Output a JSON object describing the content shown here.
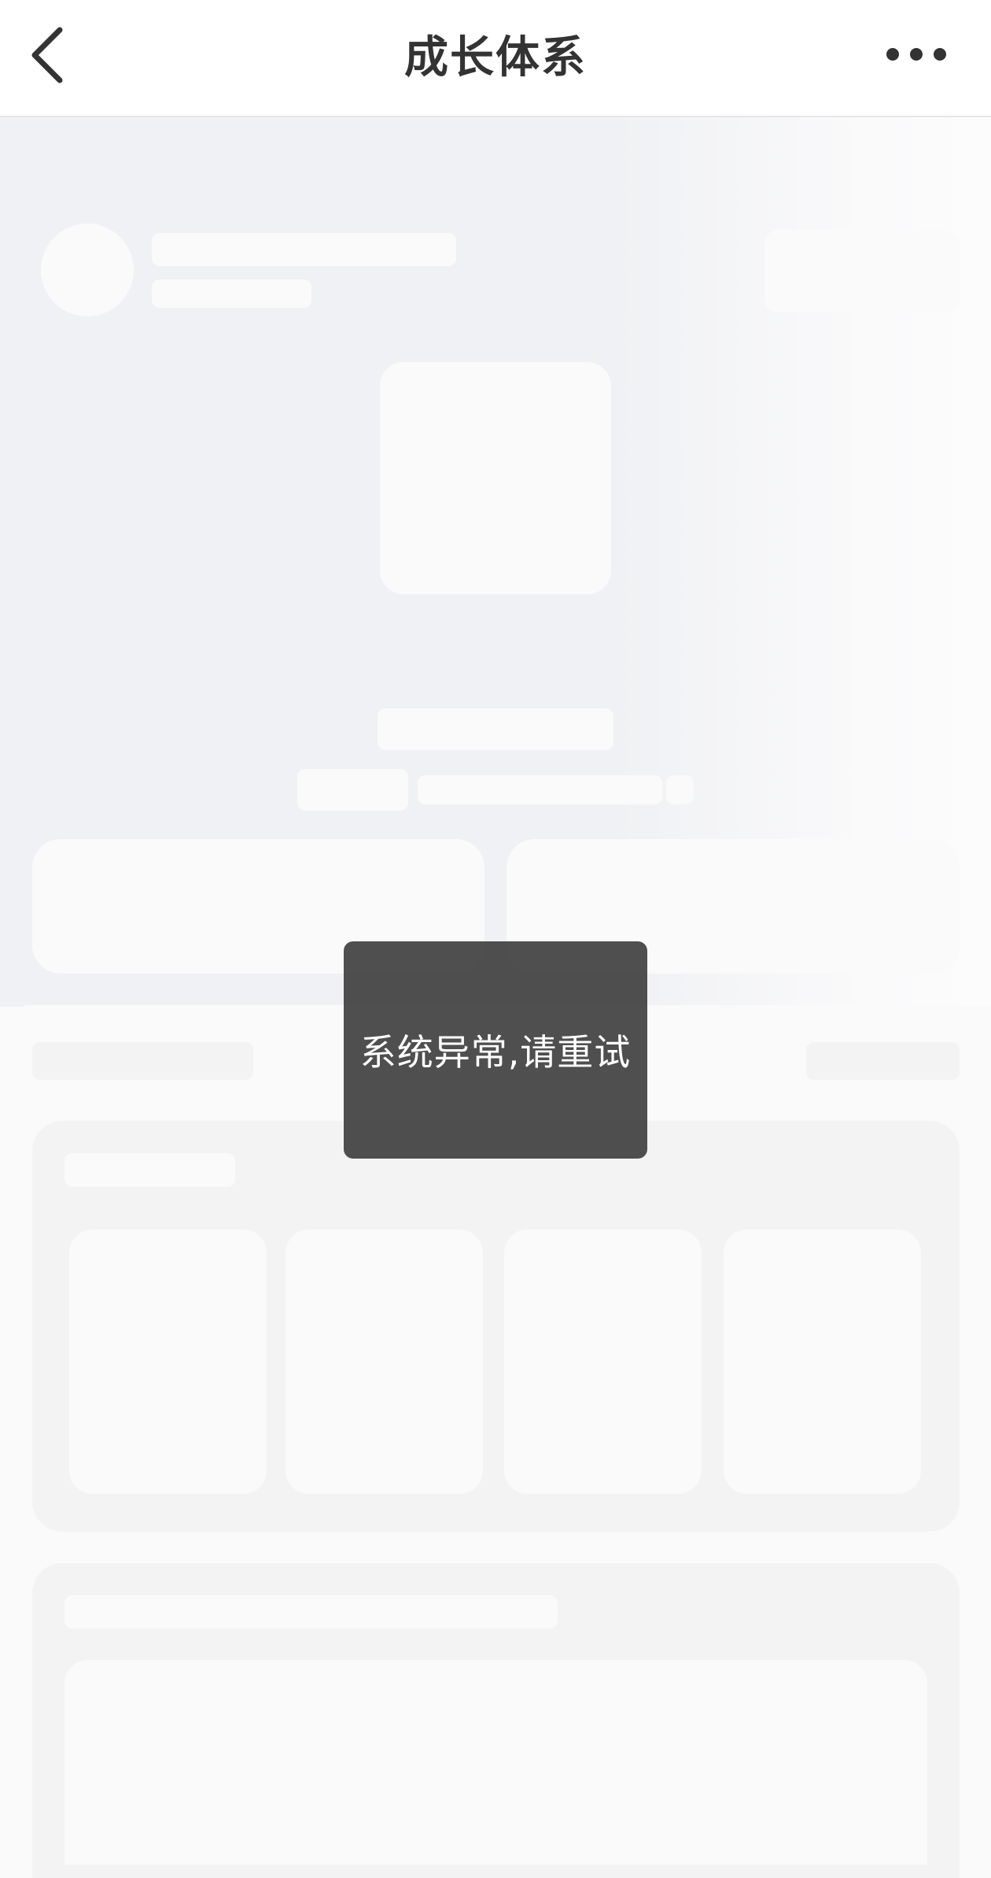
{
  "header": {
    "title": "成长体系",
    "back_icon": "chevron-left-icon",
    "more_icon": "more-horizontal-icon"
  },
  "toast": {
    "message": "系统异常,请重试"
  },
  "colors": {
    "nav_background": "#ffffff",
    "title_text": "#333333",
    "hero_background": "#f0f1f4",
    "skeleton": "#fafafa",
    "panel": "#f3f3f3",
    "toast_background": "#404040",
    "toast_text": "#ffffff"
  }
}
